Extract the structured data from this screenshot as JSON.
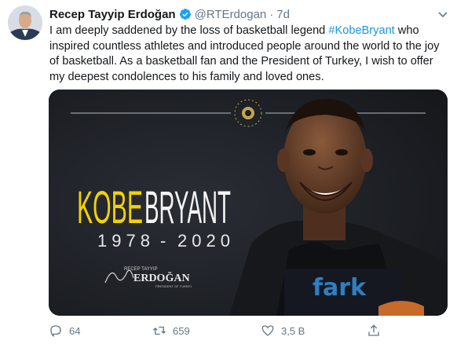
{
  "tweet": {
    "author_name": "Recep Tayyip Erdoğan",
    "handle": "@RTErdogan",
    "separator": "·",
    "time": "7d",
    "text_before": "I am deeply saddened by the loss of basketball legend ",
    "hashtag": "#KobeBryant",
    "text_after": " who inspired countless athletes and introduced people around the world to the joy of basketball. As a basketball fan and the President of Turkey, I wish to offer my deepest condolences to his family and loved ones."
  },
  "media": {
    "first_name": "KOBE",
    "last_name": "BRYANT",
    "birth_year": "1978",
    "dash": "-",
    "death_year": "2020",
    "signature_top": "RECEP TAYYIP",
    "signature_name": "ERDOĞAN",
    "signature_sub": "PRESIDENT OF TURKEY",
    "shirt_text": "fark"
  },
  "actions": {
    "replies": "64",
    "retweets": "659",
    "likes": "3,5 B"
  },
  "colors": {
    "accent": "#1b95e0",
    "muted": "#657786",
    "kobe_yellow": "#f2d200",
    "media_bg": "#1b1e23"
  }
}
